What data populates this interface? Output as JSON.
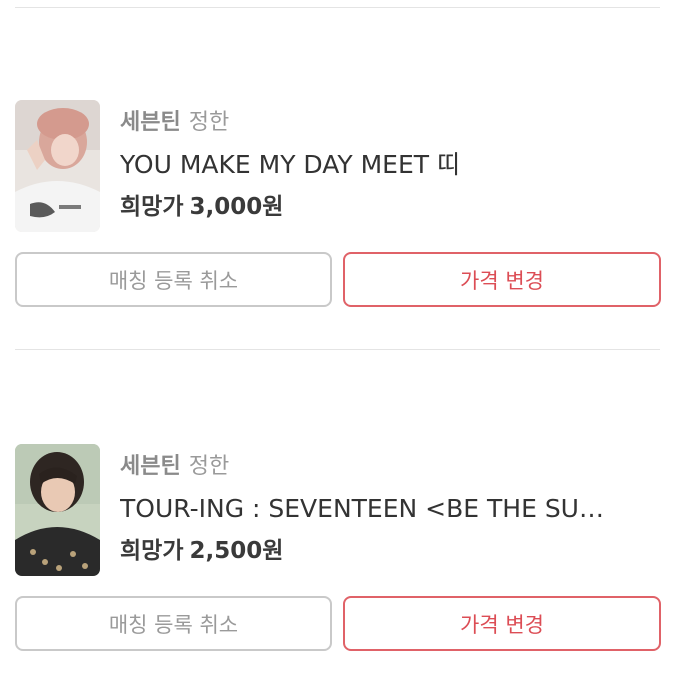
{
  "listings": [
    {
      "group": "세븐틴",
      "member": "정한",
      "title": "YOU MAKE MY DAY MEET 띠",
      "price_label": "희망가",
      "price": "3,000원",
      "cancel_label": "매칭 등록 취소",
      "change_price_label": "가격 변경"
    },
    {
      "group": "세븐틴",
      "member": "정한",
      "title": "TOUR-ING : SEVENTEEN <BE THE SU…",
      "price_label": "희망가",
      "price": "2,500원",
      "cancel_label": "매칭 등록 취소",
      "change_price_label": "가격 변경"
    }
  ],
  "colors": {
    "accent": "#dc4d55",
    "divider": "#e4e4e4",
    "muted_button": "#c9c9c9"
  }
}
